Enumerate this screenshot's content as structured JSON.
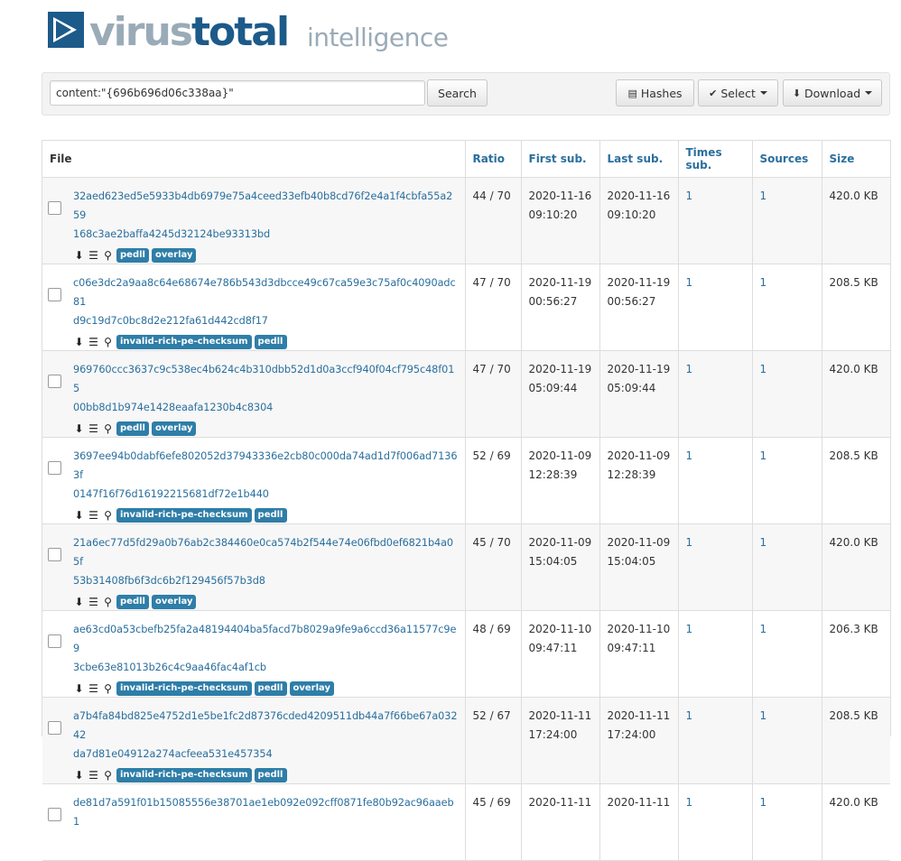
{
  "brand": {
    "virus": "virus",
    "total": "total",
    "intelligence": "intelligence"
  },
  "search": {
    "value": "content:\"{696b696d06c338aa}\"",
    "button": "Search"
  },
  "toolbar": {
    "hashes": "Hashes",
    "select": "Select",
    "download": "Download"
  },
  "columns": {
    "file": "File",
    "ratio": "Ratio",
    "first": "First sub.",
    "last": "Last sub.",
    "times": "Times sub.",
    "sources": "Sources",
    "size": "Size"
  },
  "rows": [
    {
      "hash1": "32aed623ed5e5933b4db6979e75a4ceed33efb40b8cd76f2e4a1f4cbfa55a259",
      "hash2": "168c3ae2baffa4245d32124be93313bd",
      "tags": [
        "pedll",
        "overlay"
      ],
      "ratio": "44 / 70",
      "first_date": "2020-11-16",
      "first_time": "09:10:20",
      "last_date": "2020-11-16",
      "last_time": "09:10:20",
      "times": "1",
      "sources": "1",
      "size": "420.0 KB"
    },
    {
      "hash1": "c06e3dc2a9aa8c64e68674e786b543d3dbcce49c67ca59e3c75af0c4090adc81",
      "hash2": "d9c19d7c0bc8d2e212fa61d442cd8f17",
      "tags": [
        "invalid-rich-pe-checksum",
        "pedll"
      ],
      "ratio": "47 / 70",
      "first_date": "2020-11-19",
      "first_time": "00:56:27",
      "last_date": "2020-11-19",
      "last_time": "00:56:27",
      "times": "1",
      "sources": "1",
      "size": "208.5 KB"
    },
    {
      "hash1": "969760ccc3637c9c538ec4b624c4b310dbb52d1d0a3ccf940f04cf795c48f015",
      "hash2": "00bb8d1b974e1428eaafa1230b4c8304",
      "tags": [
        "pedll",
        "overlay"
      ],
      "ratio": "47 / 70",
      "first_date": "2020-11-19",
      "first_time": "05:09:44",
      "last_date": "2020-11-19",
      "last_time": "05:09:44",
      "times": "1",
      "sources": "1",
      "size": "420.0 KB"
    },
    {
      "hash1": "3697ee94b0dabf6efe802052d37943336e2cb80c000da74ad1d7f006ad71363f",
      "hash2": "0147f16f76d16192215681df72e1b440",
      "tags": [
        "invalid-rich-pe-checksum",
        "pedll"
      ],
      "ratio": "52 / 69",
      "first_date": "2020-11-09",
      "first_time": "12:28:39",
      "last_date": "2020-11-09",
      "last_time": "12:28:39",
      "times": "1",
      "sources": "1",
      "size": "208.5 KB"
    },
    {
      "hash1": "21a6ec77d5fd29a0b76ab2c384460e0ca574b2f544e74e06fbd0ef6821b4a05f",
      "hash2": "53b31408fb6f3dc6b2f129456f57b3d8",
      "tags": [
        "pedll",
        "overlay"
      ],
      "ratio": "45 / 70",
      "first_date": "2020-11-09",
      "first_time": "15:04:05",
      "last_date": "2020-11-09",
      "last_time": "15:04:05",
      "times": "1",
      "sources": "1",
      "size": "420.0 KB"
    },
    {
      "hash1": "ae63cd0a53cbefb25fa2a48194404ba5facd7b8029a9fe9a6ccd36a11577c9e9",
      "hash2": "3cbe63e81013b26c4c9aa46fac4af1cb",
      "tags": [
        "invalid-rich-pe-checksum",
        "pedll",
        "overlay"
      ],
      "ratio": "48 / 69",
      "first_date": "2020-11-10",
      "first_time": "09:47:11",
      "last_date": "2020-11-10",
      "last_time": "09:47:11",
      "times": "1",
      "sources": "1",
      "size": "206.3 KB"
    },
    {
      "hash1": "a7b4fa84bd825e4752d1e5be1fc2d87376cded4209511db44a7f66be67a03242",
      "hash2": "da7d81e04912a274acfeea531e457354",
      "tags": [
        "invalid-rich-pe-checksum",
        "pedll"
      ],
      "ratio": "52 / 67",
      "first_date": "2020-11-11",
      "first_time": "17:24:00",
      "last_date": "2020-11-11",
      "last_time": "17:24:00",
      "times": "1",
      "sources": "1",
      "size": "208.5 KB"
    },
    {
      "hash1": "de81d7a591f01b15085556e38701ae1eb092e092cff0871fe80b92ac96aaeb1",
      "hash2": "",
      "tags": [],
      "ratio": "45 / 69",
      "first_date": "2020-11-11",
      "first_time": "",
      "last_date": "2020-11-11",
      "last_time": "",
      "times": "1",
      "sources": "1",
      "size": "420.0 KB"
    }
  ]
}
